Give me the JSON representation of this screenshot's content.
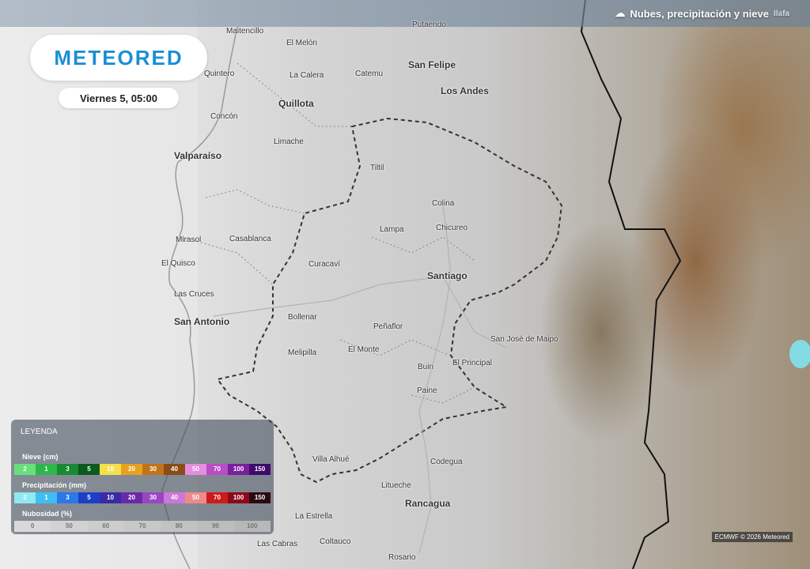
{
  "layer_title": "Nubes, precipitación y nieve",
  "layer_title_fragment": "Ilafa",
  "brand": "METEORED",
  "datetime": "Viernes 5, 05:00",
  "credit": "ECMWF © 2026 Meteored",
  "cities": [
    {
      "name": "Maitencillo",
      "big": false
    },
    {
      "name": "El Melón",
      "big": false
    },
    {
      "name": "Putaendo",
      "big": false
    },
    {
      "name": "San Felipe",
      "big": true
    },
    {
      "name": "Quintero",
      "big": false
    },
    {
      "name": "La Calera",
      "big": false
    },
    {
      "name": "Catemu",
      "big": false
    },
    {
      "name": "Los Andes",
      "big": true
    },
    {
      "name": "Quillota",
      "big": true
    },
    {
      "name": "Concón",
      "big": false
    },
    {
      "name": "Limache",
      "big": false
    },
    {
      "name": "Valparaíso",
      "big": true
    },
    {
      "name": "Tiltil",
      "big": false
    },
    {
      "name": "Colina",
      "big": false
    },
    {
      "name": "Lampa",
      "big": false
    },
    {
      "name": "Chicureo",
      "big": false
    },
    {
      "name": "Mirasol",
      "big": false
    },
    {
      "name": "Casablanca",
      "big": false
    },
    {
      "name": "El Quisco",
      "big": false
    },
    {
      "name": "Curacaví",
      "big": false
    },
    {
      "name": "Santiago",
      "big": true
    },
    {
      "name": "Las Cruces",
      "big": false
    },
    {
      "name": "San Antonio",
      "big": true
    },
    {
      "name": "Bollenar",
      "big": false
    },
    {
      "name": "Peñaflor",
      "big": false
    },
    {
      "name": "San José de Maipo",
      "big": false
    },
    {
      "name": "Melipilla",
      "big": false
    },
    {
      "name": "El Monte",
      "big": false
    },
    {
      "name": "Buin",
      "big": false
    },
    {
      "name": "El Principal",
      "big": false
    },
    {
      "name": "Paine",
      "big": false
    },
    {
      "name": "Villa Alhué",
      "big": false
    },
    {
      "name": "Codegua",
      "big": false
    },
    {
      "name": "Litueche",
      "big": false
    },
    {
      "name": "Rancagua",
      "big": true
    },
    {
      "name": "La Estrella",
      "big": false
    },
    {
      "name": "Las Cabras",
      "big": false
    },
    {
      "name": "Coltauco",
      "big": false
    },
    {
      "name": "Rosario",
      "big": false
    }
  ],
  "legend": {
    "title": "LEYENDA",
    "snow": {
      "label": "Nieve (cm)",
      "stops": [
        {
          "value": "2",
          "color": "#66e07a"
        },
        {
          "value": "1",
          "color": "#2fb64a"
        },
        {
          "value": "3",
          "color": "#188a33"
        },
        {
          "value": "5",
          "color": "#0b5a1f"
        },
        {
          "value": "10",
          "color": "#f4e04a"
        },
        {
          "value": "20",
          "color": "#e6a21f"
        },
        {
          "value": "30",
          "color": "#c0731a"
        },
        {
          "value": "40",
          "color": "#8a4d14"
        },
        {
          "value": "50",
          "color": "#e48ee0"
        },
        {
          "value": "70",
          "color": "#b84dc4"
        },
        {
          "value": "100",
          "color": "#7a1fa0"
        },
        {
          "value": "150",
          "color": "#3c0b6b"
        }
      ]
    },
    "precip": {
      "label": "Precipitación (mm)",
      "stops": [
        {
          "value": "2",
          "color": "#8ee9f2"
        },
        {
          "value": "1",
          "color": "#3fbff1"
        },
        {
          "value": "3",
          "color": "#2b78e8"
        },
        {
          "value": "5",
          "color": "#1c3fc8"
        },
        {
          "value": "10",
          "color": "#3a2aa6"
        },
        {
          "value": "20",
          "color": "#6a2aa8"
        },
        {
          "value": "30",
          "color": "#9a46c2"
        },
        {
          "value": "40",
          "color": "#cc78d8"
        },
        {
          "value": "50",
          "color": "#f08a8a"
        },
        {
          "value": "70",
          "color": "#d01a1a"
        },
        {
          "value": "100",
          "color": "#8a0a1a"
        },
        {
          "value": "150",
          "color": "#2a0a10"
        }
      ]
    },
    "clouds": {
      "label": "Nubosidad (%)",
      "stops": [
        {
          "value": "0",
          "color": "#d9d9d9"
        },
        {
          "value": "50",
          "color": "#d2d2d2"
        },
        {
          "value": "60",
          "color": "#cdcdcd"
        },
        {
          "value": "70",
          "color": "#c8c8c8"
        },
        {
          "value": "80",
          "color": "#c2c2c2"
        },
        {
          "value": "90",
          "color": "#bdbdbd"
        },
        {
          "value": "100",
          "color": "#b8b8b8"
        }
      ]
    }
  }
}
